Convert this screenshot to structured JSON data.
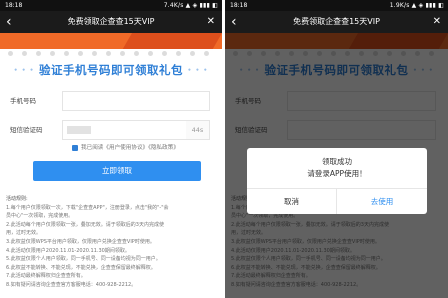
{
  "left_screen": {
    "status": {
      "time": "18:18",
      "network": "7.4K/s ▲ ◈ ▮▮▮ ◧"
    },
    "titlebar": {
      "title": "免费领取企查查15天VIP"
    },
    "form": {
      "heading": "验证手机号码即可领取礼包",
      "phone_label": "手机号码",
      "phone_placeholder": "",
      "code_label": "短信验证码",
      "code_button": "44s",
      "agreement_prefix": "我已阅读",
      "agreement_user": "《用户使用协议》",
      "agreement_privacy": "《隐私政策》",
      "submit": "立即领取"
    },
    "rules": {
      "title": "活动规则:",
      "lines": [
        "1.每个用户仅限领取一次，下载\"企查查APP\"，注册登录，点击\"我的\"-\"会",
        "员中心\"一次领取，完成使用。",
        "2.此活动每个用户仅限领取一张，叠加无效。请于领取后的3天内完成使",
        "用，过时无效。",
        "3.此权益仅限WPS平台用户领取，仅限用户兑换企查查VIP时使用。",
        "4.此活动仅限用户2020.11.01-2020.11.30期间领取。",
        "5.此权益仅限个人用户领取，同一手机号、同一设备均视为同一用户。",
        "6.此权益不能转换、不能兑现，不能兑换，企查查保留最终解释权。",
        "7.此活动最终解释权归企查查所有。",
        "8.如有疑问请咨询企查查官方客服电话：400-928-2212。"
      ]
    }
  },
  "right_screen": {
    "status": {
      "time": "18:18",
      "network": "1.9K/s ▲ ◈ ▮▮▮ ◧"
    },
    "titlebar": {
      "title": "免费领取企查查15天VIP"
    },
    "dialog": {
      "line1": "领取成功",
      "line2": "请登录APP使用！",
      "cancel": "取消",
      "confirm": "去使用"
    }
  },
  "colors": {
    "accent": "#2f8ff0",
    "heading": "#2f7fd6",
    "banner": "#f06a28",
    "overlay": "rgba(0,0,0,0.62)"
  },
  "icons": {
    "back": "chevron-left-icon",
    "close": "close-icon"
  }
}
